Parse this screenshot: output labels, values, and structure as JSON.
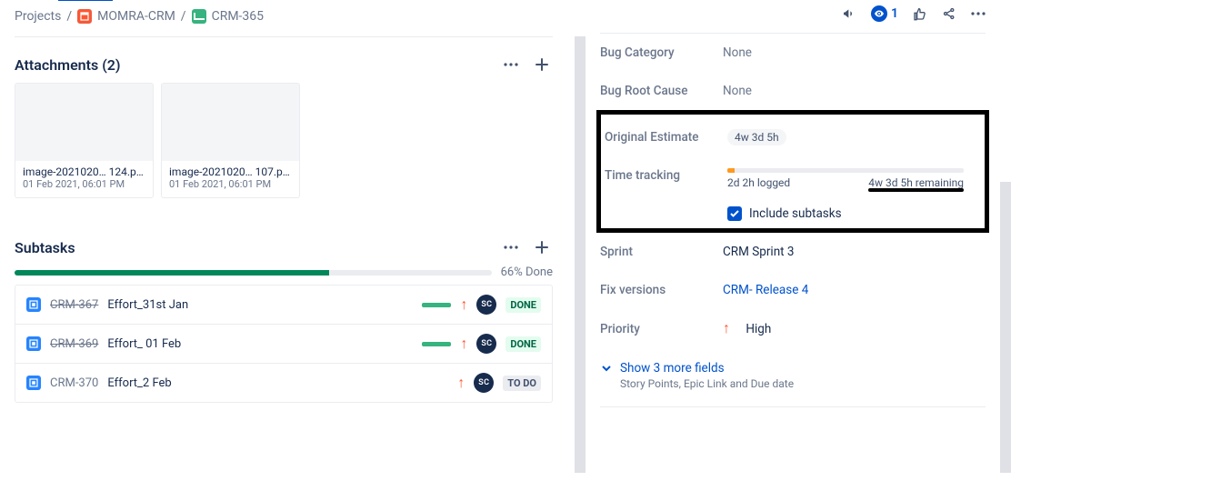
{
  "breadcrumb": {
    "root": "Projects",
    "project": "MOMRA-CRM",
    "issue": "CRM-365"
  },
  "attachments": {
    "heading": "Attachments (2)",
    "items": [
      {
        "name": "image-2021020… 124.png",
        "time": "01 Feb 2021, 06:01 PM"
      },
      {
        "name": "image-2021020… 107.png",
        "time": "01 Feb 2021, 06:01 PM"
      }
    ]
  },
  "subtasks": {
    "heading": "Subtasks",
    "progress_pct": 66,
    "progress_label": "66% Done",
    "items": [
      {
        "key": "CRM-367",
        "keydone": true,
        "title": "Effort_31st Jan",
        "bar": true,
        "assignee": "SC",
        "status": "DONE",
        "status_class": "done"
      },
      {
        "key": "CRM-369",
        "keydone": true,
        "title": "Effort_ 01 Feb",
        "bar": true,
        "assignee": "SC",
        "status": "DONE",
        "status_class": "done"
      },
      {
        "key": "CRM-370",
        "keydone": false,
        "title": "Effort_2 Feb",
        "bar": false,
        "assignee": "SC",
        "status": "TO DO",
        "status_class": "todo"
      }
    ]
  },
  "details": {
    "watch_count": "1",
    "bug_category_label": "Bug Category",
    "bug_category_value": "None",
    "bug_root_label": "Bug Root Cause",
    "bug_root_value": "None",
    "orig_est_label": "Original Estimate",
    "orig_est_value": "4w 3d 5h",
    "tt_label": "Time tracking",
    "tt_logged": "2d 2h logged",
    "tt_remaining": "4w 3d 5h remaining",
    "include_subtasks": "Include subtasks",
    "sprint_label": "Sprint",
    "sprint_value": "CRM Sprint 3",
    "fix_label": "Fix versions",
    "fix_value": "CRM- Release 4",
    "priority_label": "Priority",
    "priority_value": "High",
    "show_more": "Show 3 more fields",
    "more_desc": "Story Points, Epic Link and Due date"
  }
}
